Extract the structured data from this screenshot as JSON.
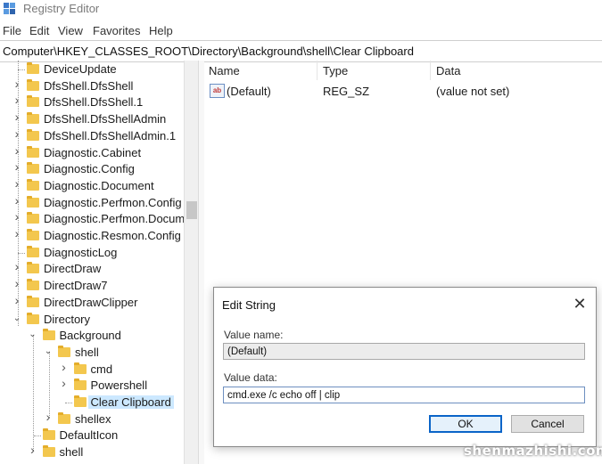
{
  "window": {
    "title": "Registry Editor"
  },
  "menu": [
    "File",
    "Edit",
    "View",
    "Favorites",
    "Help"
  ],
  "address": "Computer\\HKEY_CLASSES_ROOT\\Directory\\Background\\shell\\Clear Clipboard",
  "tree": [
    {
      "label": "DeviceUpdate",
      "depth": 0,
      "arrow": "none"
    },
    {
      "label": "DfsShell.DfsShell",
      "depth": 0,
      "arrow": "collapsed"
    },
    {
      "label": "DfsShell.DfsShell.1",
      "depth": 0,
      "arrow": "collapsed"
    },
    {
      "label": "DfsShell.DfsShellAdmin",
      "depth": 0,
      "arrow": "collapsed"
    },
    {
      "label": "DfsShell.DfsShellAdmin.1",
      "depth": 0,
      "arrow": "collapsed"
    },
    {
      "label": "Diagnostic.Cabinet",
      "depth": 0,
      "arrow": "collapsed"
    },
    {
      "label": "Diagnostic.Config",
      "depth": 0,
      "arrow": "collapsed"
    },
    {
      "label": "Diagnostic.Document",
      "depth": 0,
      "arrow": "collapsed"
    },
    {
      "label": "Diagnostic.Perfmon.Config",
      "depth": 0,
      "arrow": "collapsed"
    },
    {
      "label": "Diagnostic.Perfmon.Docume",
      "depth": 0,
      "arrow": "collapsed"
    },
    {
      "label": "Diagnostic.Resmon.Config",
      "depth": 0,
      "arrow": "collapsed"
    },
    {
      "label": "DiagnosticLog",
      "depth": 0,
      "arrow": "none"
    },
    {
      "label": "DirectDraw",
      "depth": 0,
      "arrow": "collapsed"
    },
    {
      "label": "DirectDraw7",
      "depth": 0,
      "arrow": "collapsed"
    },
    {
      "label": "DirectDrawClipper",
      "depth": 0,
      "arrow": "collapsed"
    },
    {
      "label": "Directory",
      "depth": 0,
      "arrow": "expanded"
    },
    {
      "label": "Background",
      "depth": 1,
      "arrow": "expanded"
    },
    {
      "label": "shell",
      "depth": 2,
      "arrow": "expanded"
    },
    {
      "label": "cmd",
      "depth": 3,
      "arrow": "collapsed"
    },
    {
      "label": "Powershell",
      "depth": 3,
      "arrow": "collapsed"
    },
    {
      "label": "Clear Clipboard",
      "depth": 3,
      "arrow": "none",
      "selected": true
    },
    {
      "label": "shellex",
      "depth": 2,
      "arrow": "collapsed"
    },
    {
      "label": "DefaultIcon",
      "depth": 1,
      "arrow": "none"
    },
    {
      "label": "shell",
      "depth": 1,
      "arrow": "collapsed"
    }
  ],
  "list": {
    "columns": [
      "Name",
      "Type",
      "Data"
    ],
    "rows": [
      {
        "icon": "string-value-icon",
        "icon_text": "ab",
        "name": "(Default)",
        "type": "REG_SZ",
        "data": "(value not set)"
      }
    ]
  },
  "dialog": {
    "title": "Edit String",
    "close": "✕",
    "value_name_label": "Value name:",
    "value_name": "(Default)",
    "value_data_label": "Value data:",
    "value_data": "cmd.exe /c echo off | clip",
    "ok": "OK",
    "cancel": "Cancel"
  },
  "watermark": "shenmazhishi.com",
  "colors": {
    "folder": "#f3c74e",
    "selection": "#cce8ff",
    "ok_border": "#0a64c8"
  }
}
